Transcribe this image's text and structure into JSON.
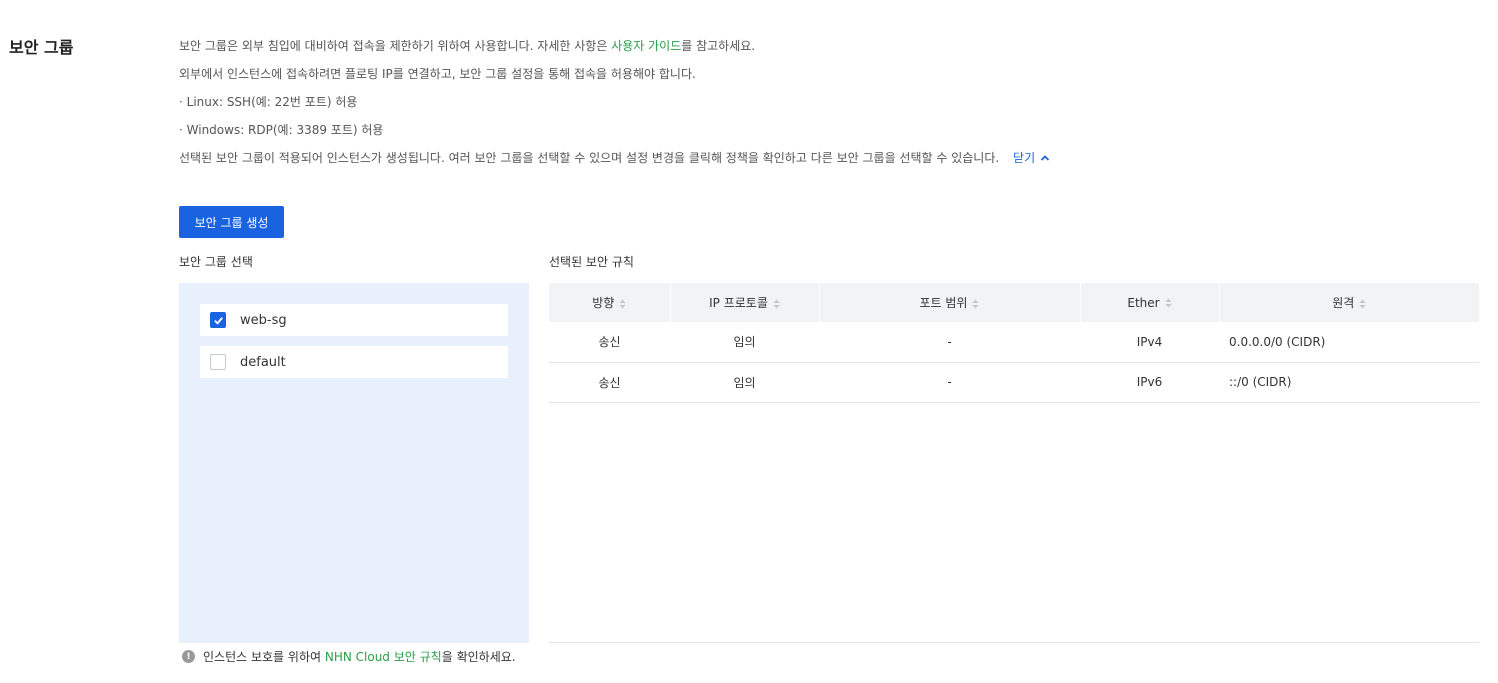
{
  "section_title": "보안 그룹",
  "description": {
    "line1_before": "보안 그룹은 외부 침입에 대비하여 접속을 제한하기 위하여 사용합니다. 자세한 사항은 ",
    "line1_link": "사용자 가이드",
    "line1_after": "를 참고하세요.",
    "line2": "외부에서 인스턴스에 접속하려면 플로팅 IP를 연결하고, 보안 그룹 설정을 통해 접속을 허용해야 합니다.",
    "line3": "· Linux: SSH(예: 22번 포트) 허용",
    "line4": "· Windows: RDP(예: 3389 포트) 허용",
    "line5": "선택된 보안 그룹이 적용되어 인스턴스가 생성됩니다. 여러 보안 그룹을 선택할 수 있으며 설정 변경을 클릭해 정책을 확인하고 다른 보안 그룹을 선택할 수 있습니다.",
    "close_label": "닫기"
  },
  "create_button_label": "보안 그룹 생성",
  "select_label": "보안 그룹 선택",
  "rules_label": "선택된 보안 규칙",
  "security_groups": [
    {
      "name": "web-sg",
      "checked": true
    },
    {
      "name": "default",
      "checked": false
    }
  ],
  "rules_table": {
    "headers": [
      "방향",
      "IP 프로토콜",
      "포트 범위",
      "Ether",
      "원격"
    ],
    "rows": [
      [
        "송신",
        "임의",
        "-",
        "IPv4",
        "0.0.0.0/0 (CIDR)"
      ],
      [
        "송신",
        "임의",
        "-",
        "IPv6",
        "::/0 (CIDR)"
      ]
    ]
  },
  "notice": {
    "before": "인스턴스 보호를 위하여 ",
    "link": "NHN Cloud 보안 규칙",
    "after": "을 확인하세요.",
    "icon": "!"
  },
  "colors": {
    "accent": "#1a63e0",
    "link_green": "#2a9d4a",
    "panel_bg": "#e8f0fd"
  }
}
